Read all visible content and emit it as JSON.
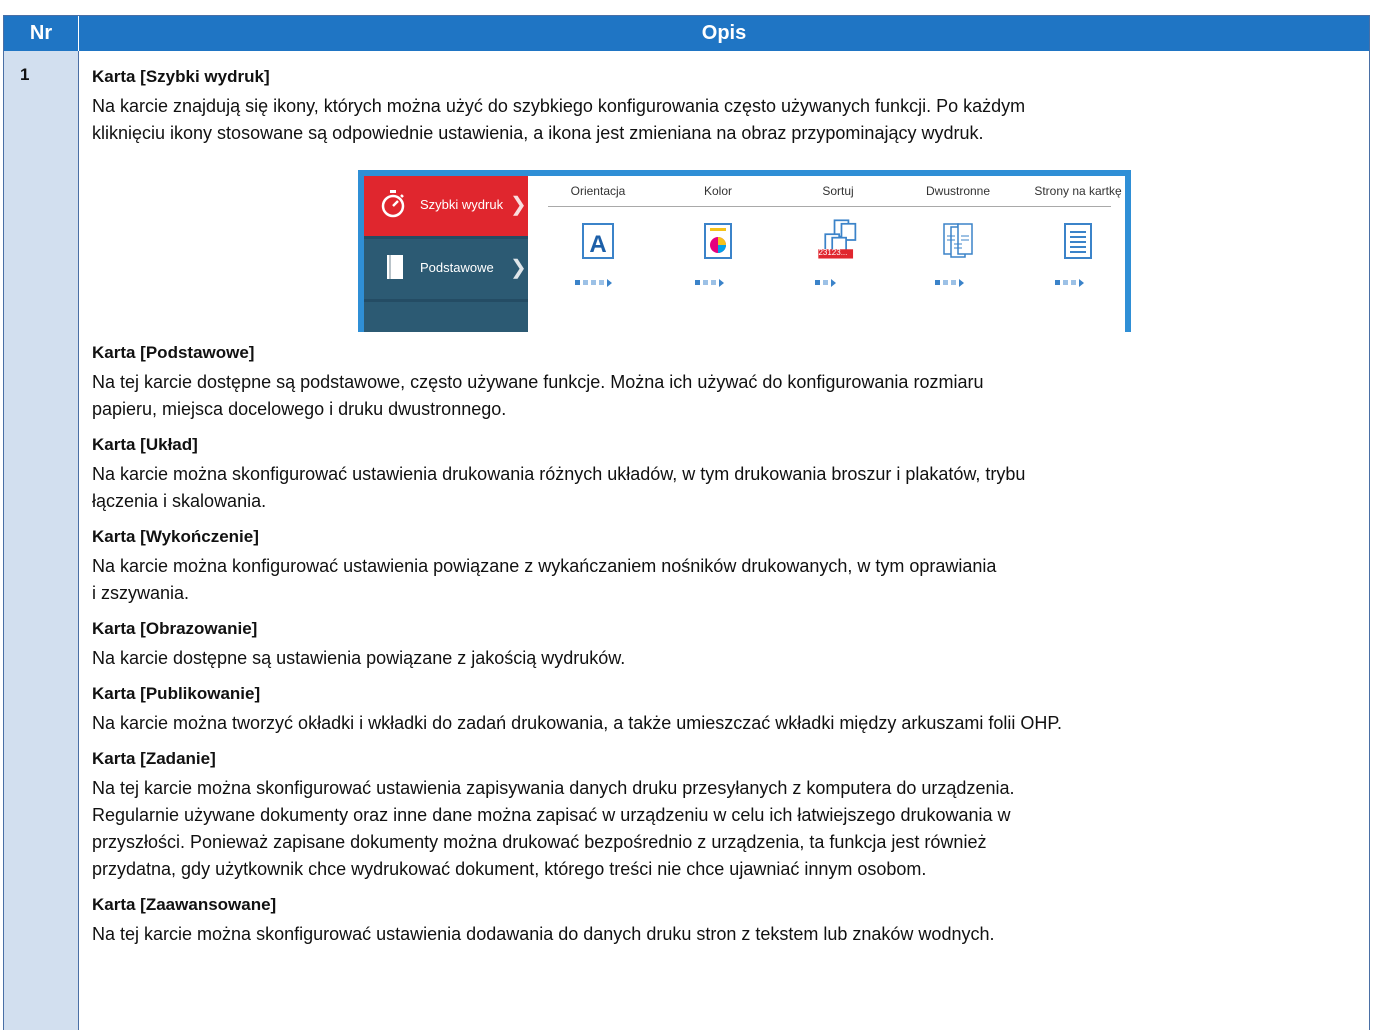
{
  "header": {
    "nr": "Nr",
    "opis": "Opis"
  },
  "row": {
    "nr": "1",
    "sections": [
      {
        "title": "Karta [Szybki wydruk]",
        "lines": [
          "Na karcie znajdują się ikony, których można użyć do szybkiego konfigurowania często używanych funkcji. Po każdym",
          "kliknięciu ikony stosowane są odpowiednie ustawienia, a ikona jest zmieniana na obraz przypominający wydruk."
        ]
      },
      {
        "title": "Karta [Podstawowe]",
        "lines": [
          "Na tej karcie dostępne są podstawowe, często używane funkcje. Można ich używać do konfigurowania rozmiaru",
          "papieru, miejsca docelowego i druku dwustronnego."
        ]
      },
      {
        "title": "Karta [Układ]",
        "lines": [
          "Na karcie można skonfigurować ustawienia drukowania różnych układów, w tym drukowania broszur i plakatów, trybu",
          "łączenia i skalowania."
        ]
      },
      {
        "title": "Karta [Wykończenie]",
        "lines": [
          "Na karcie można konfigurować ustawienia powiązane z wykańczaniem nośników drukowanych, w tym oprawiania",
          "i zszywania."
        ]
      },
      {
        "title": "Karta [Obrazowanie]",
        "lines": [
          "Na karcie dostępne są ustawienia powiązane z jakością wydruków."
        ]
      },
      {
        "title": "Karta [Publikowanie]",
        "lines": [
          "Na karcie można tworzyć okładki i wkładki do zadań drukowania, a także umieszczać wkładki między arkuszami folii OHP."
        ]
      },
      {
        "title": "Karta [Zadanie]",
        "lines": [
          "Na tej karcie można skonfigurować ustawienia zapisywania danych druku przesyłanych z komputera do urządzenia.",
          "Regularnie używane dokumenty oraz inne dane można zapisać w urządzeniu w celu ich łatwiejszego drukowania w",
          "przyszłości. Ponieważ zapisane dokumenty można drukować bezpośrednio z urządzenia, ta funkcja jest również",
          "przydatna, gdy użytkownik chce wydrukować dokument, którego treści nie chce ujawniać innym osobom."
        ]
      },
      {
        "title": "Karta [Zaawansowane]",
        "lines": [
          "Na tej karcie można skonfigurować ustawienia dodawania do danych druku stron z tekstem lub znaków wodnych."
        ]
      }
    ]
  },
  "screenshot": {
    "sidebar": {
      "active": "Szybki wydruk",
      "second": "Podstawowe"
    },
    "columns": [
      "Orientacja",
      "Kolor",
      "Sortuj",
      "Dwustronne",
      "Strony na kartkę"
    ],
    "sort_badge": "123123..."
  },
  "colors": {
    "header": "#1f75c4",
    "nr_column": "#d2dfef",
    "active_tab": "#e0262e",
    "sidebar": "#244c64",
    "frame": "#2f8fd6"
  }
}
